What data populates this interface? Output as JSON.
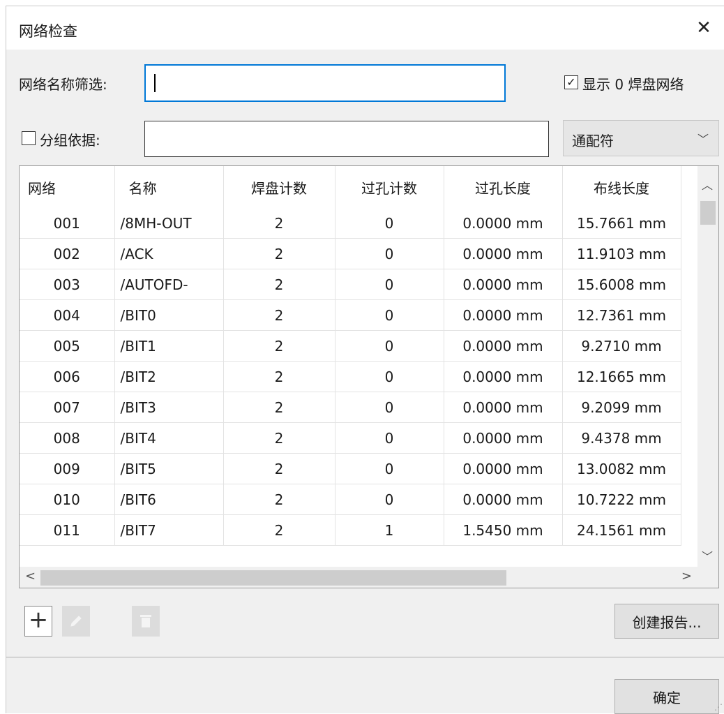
{
  "dialog": {
    "title": "网络检查",
    "close_glyph": "✕"
  },
  "filters": {
    "net_name_filter_label": "网络名称筛选:",
    "net_name_filter_value": "",
    "show_zero_pad_checked": true,
    "show_zero_pad_label": "显示 0 焊盘网络",
    "group_by_checked": false,
    "group_by_label": "分组依据:",
    "group_by_value": "",
    "match_mode": "通配符"
  },
  "table": {
    "columns": [
      "网络",
      "名称",
      "焊盘计数",
      "过孔计数",
      "过孔长度",
      "布线长度"
    ],
    "rows": [
      [
        "001",
        "/8MH-OUT",
        "2",
        "0",
        "0.0000 mm",
        "15.7661 mm"
      ],
      [
        "002",
        "/ACK",
        "2",
        "0",
        "0.0000 mm",
        "11.9103 mm"
      ],
      [
        "003",
        "/AUTOFD-",
        "2",
        "0",
        "0.0000 mm",
        "15.6008 mm"
      ],
      [
        "004",
        "/BIT0",
        "2",
        "0",
        "0.0000 mm",
        "12.7361 mm"
      ],
      [
        "005",
        "/BIT1",
        "2",
        "0",
        "0.0000 mm",
        "9.2710 mm"
      ],
      [
        "006",
        "/BIT2",
        "2",
        "0",
        "0.0000 mm",
        "12.1665 mm"
      ],
      [
        "007",
        "/BIT3",
        "2",
        "0",
        "0.0000 mm",
        "9.2099 mm"
      ],
      [
        "008",
        "/BIT4",
        "2",
        "0",
        "0.0000 mm",
        "9.4378 mm"
      ],
      [
        "009",
        "/BIT5",
        "2",
        "0",
        "0.0000 mm",
        "13.0082 mm"
      ],
      [
        "010",
        "/BIT6",
        "2",
        "0",
        "0.0000 mm",
        "10.7222 mm"
      ],
      [
        "011",
        "/BIT7",
        "2",
        "1",
        "1.5450 mm",
        "24.1561 mm"
      ]
    ]
  },
  "toolbar": {
    "add_icon": "plus-icon",
    "edit_icon": "pencil-icon",
    "delete_icon": "trash-icon"
  },
  "buttons": {
    "create_report": "创建报告...",
    "ok": "确定"
  },
  "colors": {
    "focus_border": "#0078d7",
    "dialog_bg": "#f0f0f0"
  }
}
